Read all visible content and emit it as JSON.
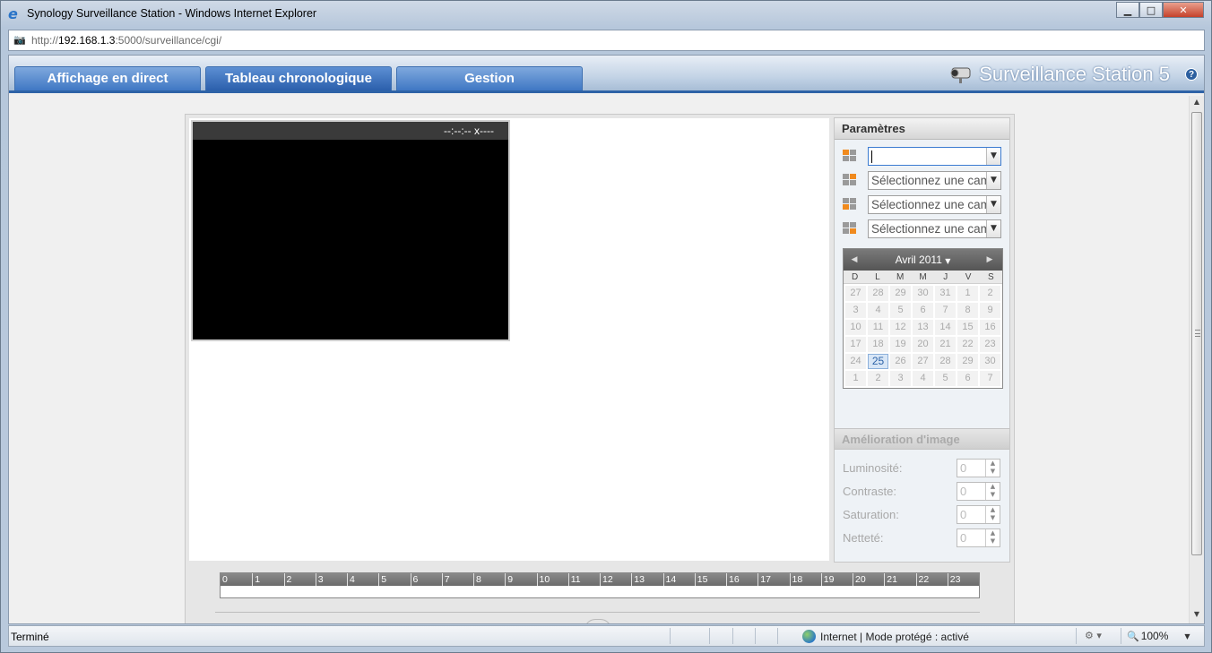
{
  "window": {
    "title": "Synology Surveillance Station - Windows Internet Explorer",
    "controls": {
      "minimize": "▁",
      "maximize": "□",
      "close": "✕"
    }
  },
  "address": {
    "prefix": "http://",
    "host": "192.168.1.3",
    "path": ":5000/surveillance/cgi/"
  },
  "app": {
    "tabs": [
      {
        "label": "Affichage en direct"
      },
      {
        "label": "Tableau chronologique"
      },
      {
        "label": "Gestion"
      }
    ],
    "brand": "Surveillance Station 5",
    "help": "?"
  },
  "viewer": {
    "timestamp": "--:--:-- x----"
  },
  "params": {
    "title": "Paramètres",
    "camera_selects": [
      {
        "value": ""
      },
      {
        "value": "Sélectionnez une caméra"
      },
      {
        "value": "Sélectionnez une caméra"
      },
      {
        "value": "Sélectionnez une caméra"
      }
    ]
  },
  "calendar": {
    "month": "Avril 2011",
    "weekdays": [
      "D",
      "L",
      "M",
      "M",
      "J",
      "V",
      "S"
    ],
    "days": [
      "27",
      "28",
      "29",
      "30",
      "31",
      "1",
      "2",
      "3",
      "4",
      "5",
      "6",
      "7",
      "8",
      "9",
      "10",
      "11",
      "12",
      "13",
      "14",
      "15",
      "16",
      "17",
      "18",
      "19",
      "20",
      "21",
      "22",
      "23",
      "24",
      "25",
      "26",
      "27",
      "28",
      "29",
      "30",
      "1",
      "2",
      "3",
      "4",
      "5",
      "6",
      "7"
    ],
    "today": "25"
  },
  "enhancement": {
    "title": "Amélioration d'image",
    "rows": [
      {
        "label": "Luminosité:",
        "value": "0"
      },
      {
        "label": "Contraste:",
        "value": "0"
      },
      {
        "label": "Saturation:",
        "value": "0"
      },
      {
        "label": "Netteté:",
        "value": "0"
      }
    ]
  },
  "timeline": {
    "hours": [
      "0",
      "1",
      "2",
      "3",
      "4",
      "5",
      "6",
      "7",
      "8",
      "9",
      "10",
      "11",
      "12",
      "13",
      "14",
      "15",
      "16",
      "17",
      "18",
      "19",
      "20",
      "21",
      "22",
      "23"
    ]
  },
  "status": {
    "text": "Terminé",
    "zone": "Internet | Mode protégé : activé",
    "zoom": "100%"
  }
}
